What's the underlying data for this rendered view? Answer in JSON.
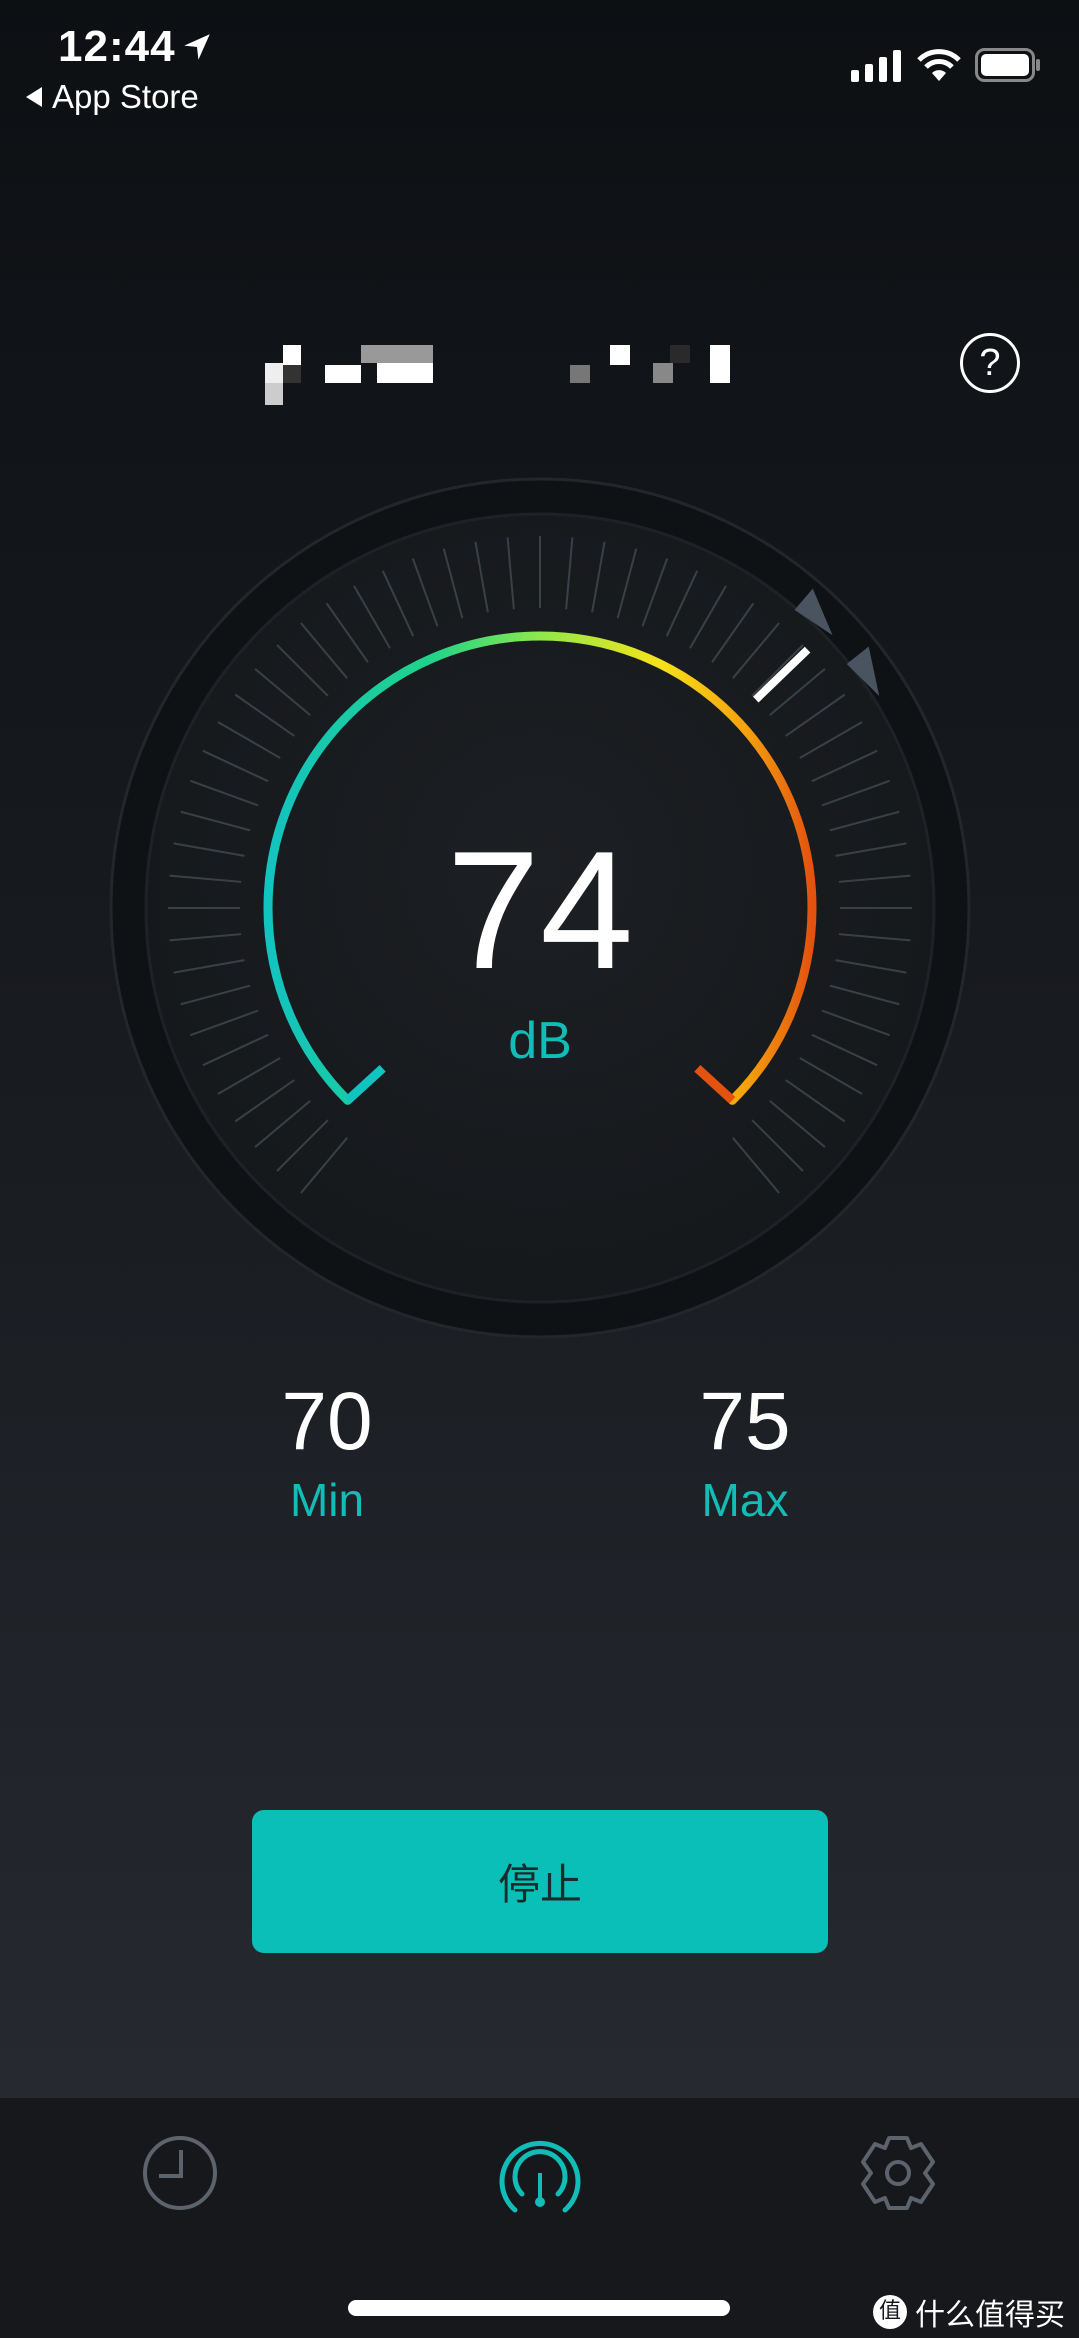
{
  "status_bar": {
    "time": "12:44",
    "back_label": "App Store",
    "icons": [
      "location-arrow-icon",
      "signal-icon",
      "wifi-icon",
      "battery-icon"
    ]
  },
  "header": {
    "title_redacted": true,
    "help_label": "?"
  },
  "gauge": {
    "value": "74",
    "unit": "dB",
    "arc_colors": [
      "#13c3c0",
      "#1fd38a",
      "#8ee84c",
      "#f7e21a",
      "#f4a10d",
      "#e3520f"
    ]
  },
  "stats": {
    "min_value": "70",
    "min_label": "Min",
    "max_value": "75",
    "max_label": "Max"
  },
  "stop_button": {
    "label": "停止",
    "color": "#0bbfb9"
  },
  "tabbar": {
    "tabs": [
      {
        "icon": "history-clock-icon",
        "active": false
      },
      {
        "icon": "meter-gauge-icon",
        "active": true
      },
      {
        "icon": "settings-gear-icon",
        "active": false
      }
    ],
    "accent": "#12bdb7"
  },
  "watermark": {
    "logo": "值",
    "text": "什么值得买"
  }
}
